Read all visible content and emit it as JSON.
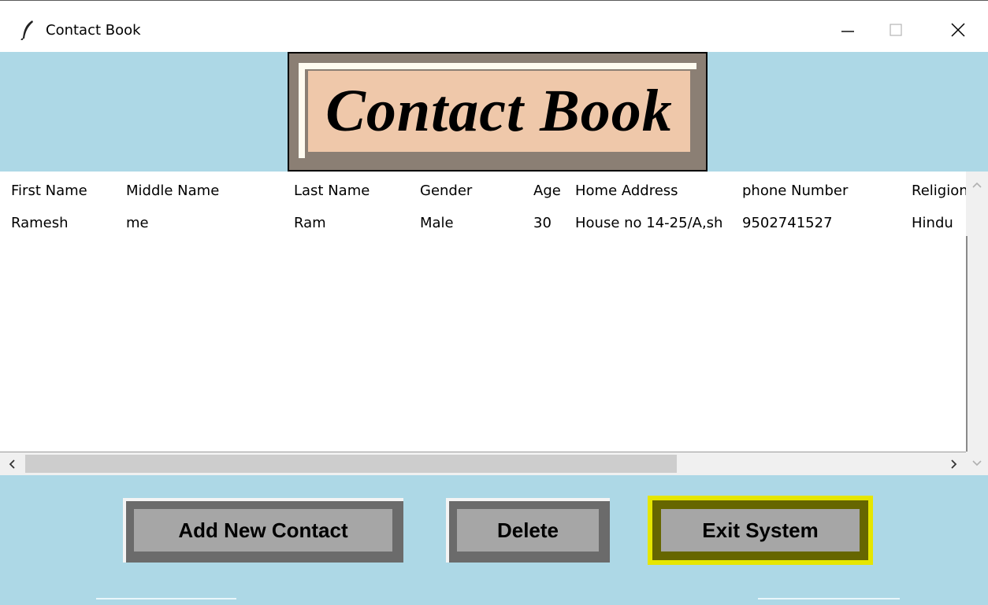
{
  "window": {
    "title": "Contact Book",
    "icon": "feather-icon"
  },
  "header": {
    "title": "Contact Book"
  },
  "table": {
    "columns": [
      "First Name",
      "Middle Name",
      "Last Name",
      "Gender",
      "Age",
      "Home Address",
      "phone Number",
      "Religion"
    ],
    "rows": [
      [
        "Ramesh",
        "me",
        "Ram",
        "Male",
        "30",
        "House no 14-25/A,sh",
        "9502741527",
        "Hindu"
      ]
    ]
  },
  "buttons": {
    "add_label": "Add New Contact",
    "delete_label": "Delete",
    "exit_label": "Exit System"
  },
  "colors": {
    "background": "#add8e6",
    "title_plate": "#efc8aa",
    "button_face": "#a6a6a6",
    "exit_highlight": "#e6e600"
  }
}
